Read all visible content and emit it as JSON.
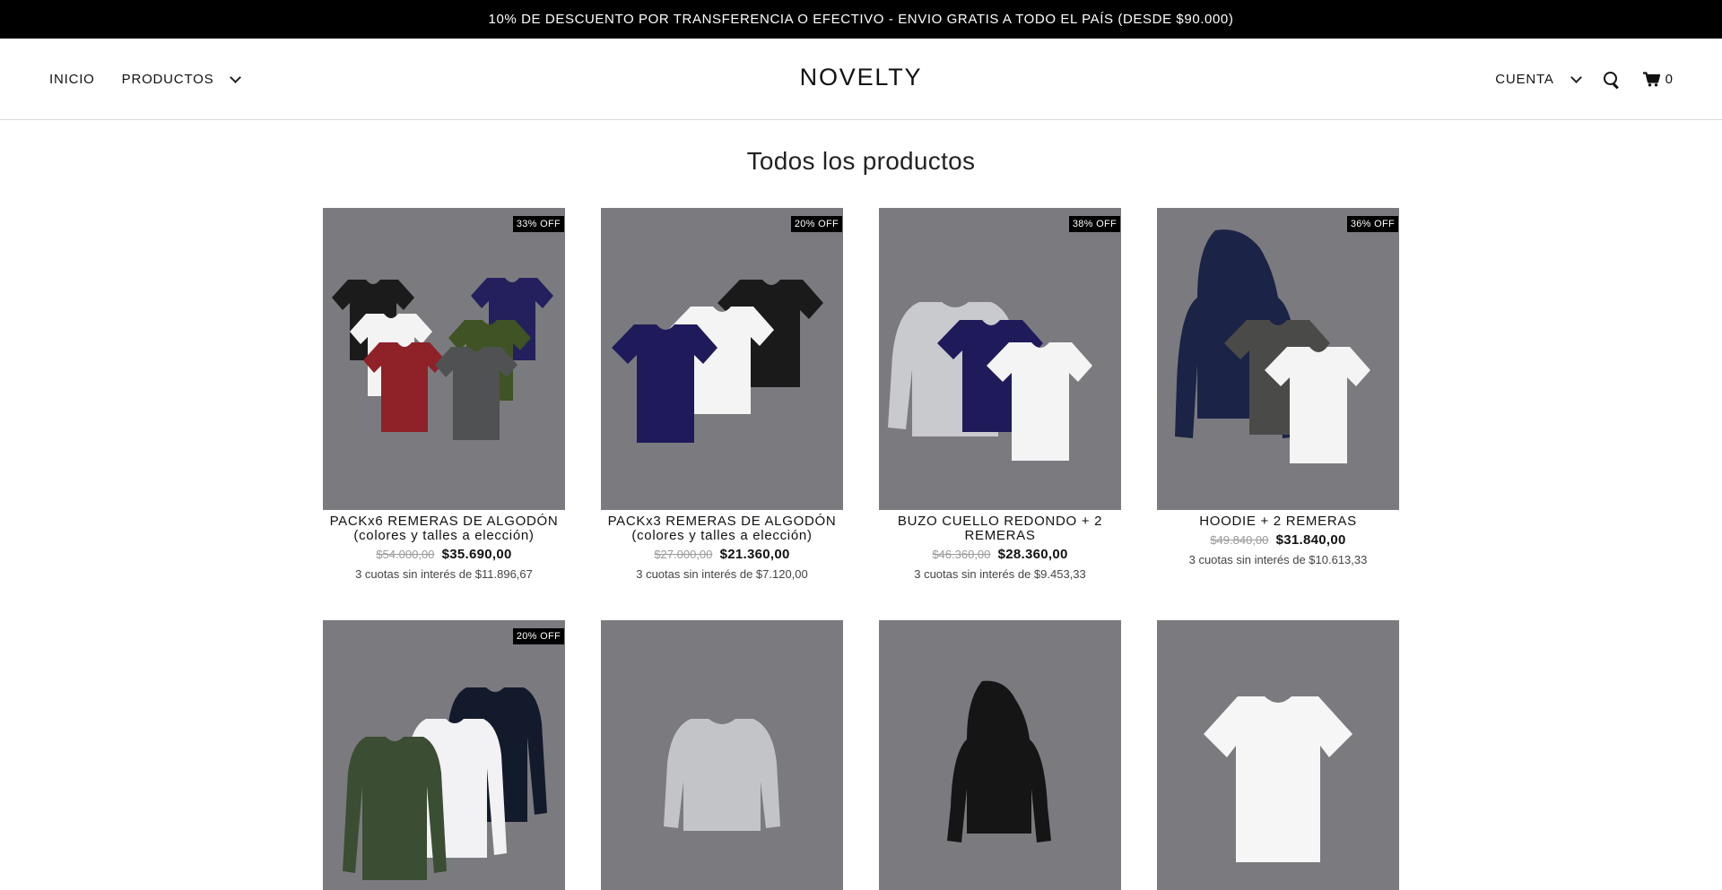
{
  "announcement": "10% DE DESCUENTO POR TRANSFERENCIA O EFECTIVO - ENVIO GRATIS A TODO EL PAÍS (DESDE $90.000)",
  "nav": {
    "inicio": "INICIO",
    "productos": "PRODUCTOS",
    "cuenta": "CUENTA",
    "cart_count": "0"
  },
  "logo": "NOVELTY",
  "page_title": "Todos los productos",
  "products": [
    {
      "badge": "33% OFF",
      "name_line1": "PACKx6 REMERAS DE ALGODÓN",
      "name_line2": "(colores y talles a elección)",
      "old_price": "$54.000,00",
      "price": "$35.690,00",
      "installments": "3 cuotas sin interés de $11.896,67"
    },
    {
      "badge": "20% OFF",
      "name_line1": "PACKx3 REMERAS DE ALGODÓN",
      "name_line2": "(colores y talles a elección)",
      "old_price": "$27.000,00",
      "price": "$21.360,00",
      "installments": "3 cuotas sin interés de $7.120,00"
    },
    {
      "badge": "38% OFF",
      "name_line1": "BUZO CUELLO REDONDO + 2",
      "name_line2": "REMERAS",
      "old_price": "$46.360,00",
      "price": "$28.360,00",
      "installments": "3 cuotas sin interés de $9.453,33"
    },
    {
      "badge": "36% OFF",
      "name_line1": "HOODIE + 2 REMERAS",
      "name_line2": "",
      "old_price": "$49.840,00",
      "price": "$31.840,00",
      "installments": "3 cuotas sin interés de $10.613,33"
    },
    {
      "badge": "20% OFF"
    },
    {
      "badge": ""
    },
    {
      "badge": ""
    },
    {
      "badge": ""
    }
  ],
  "icons": {
    "search": "search-icon",
    "cart": "cart-icon",
    "chevron": "chevron-down-icon"
  }
}
